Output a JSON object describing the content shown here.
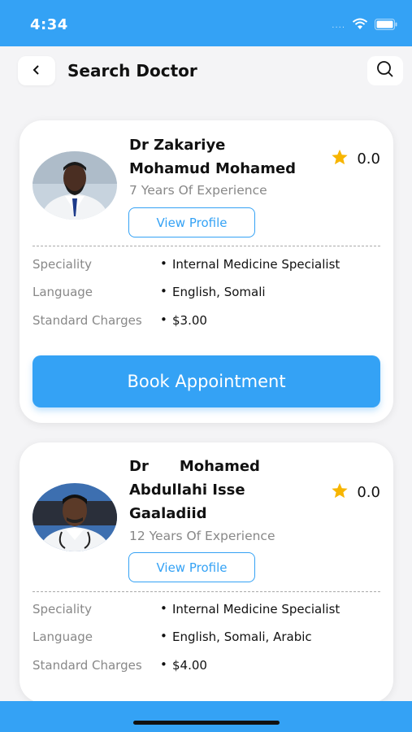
{
  "status_bar": {
    "time": "4:34",
    "signal_dots": "....",
    "wifi_icon": "wifi-icon",
    "battery_icon": "battery-icon"
  },
  "header": {
    "title": "Search Doctor",
    "back_icon": "chevron-left-icon",
    "search_icon": "search-icon"
  },
  "colors": {
    "accent": "#34a2f5",
    "star": "#f7b500"
  },
  "doctors": [
    {
      "name_line1": "Dr Zakariye",
      "name_line2": "Mohamud Mohamed",
      "experience": "7 Years Of Experience",
      "view_profile": "View Profile",
      "rating": "0.0",
      "speciality_label": "Speciality",
      "speciality": "Internal Medicine Specialist",
      "language_label": "Language",
      "language": "English, Somali",
      "charges_label": "Standard Charges",
      "charges": "$3.00",
      "book_label": "Book Appointment"
    },
    {
      "name_word1": "Dr",
      "name_word2": "Mohamed",
      "name_line2": "Abdullahi Isse",
      "name_line3": "Gaaladiid",
      "experience": "12 Years Of Experience",
      "view_profile": "View Profile",
      "rating": "0.0",
      "speciality_label": "Speciality",
      "speciality": "Internal Medicine Specialist",
      "language_label": "Language",
      "language": "English, Somali, Arabic",
      "charges_label": "Standard Charges",
      "charges": "$4.00"
    }
  ]
}
